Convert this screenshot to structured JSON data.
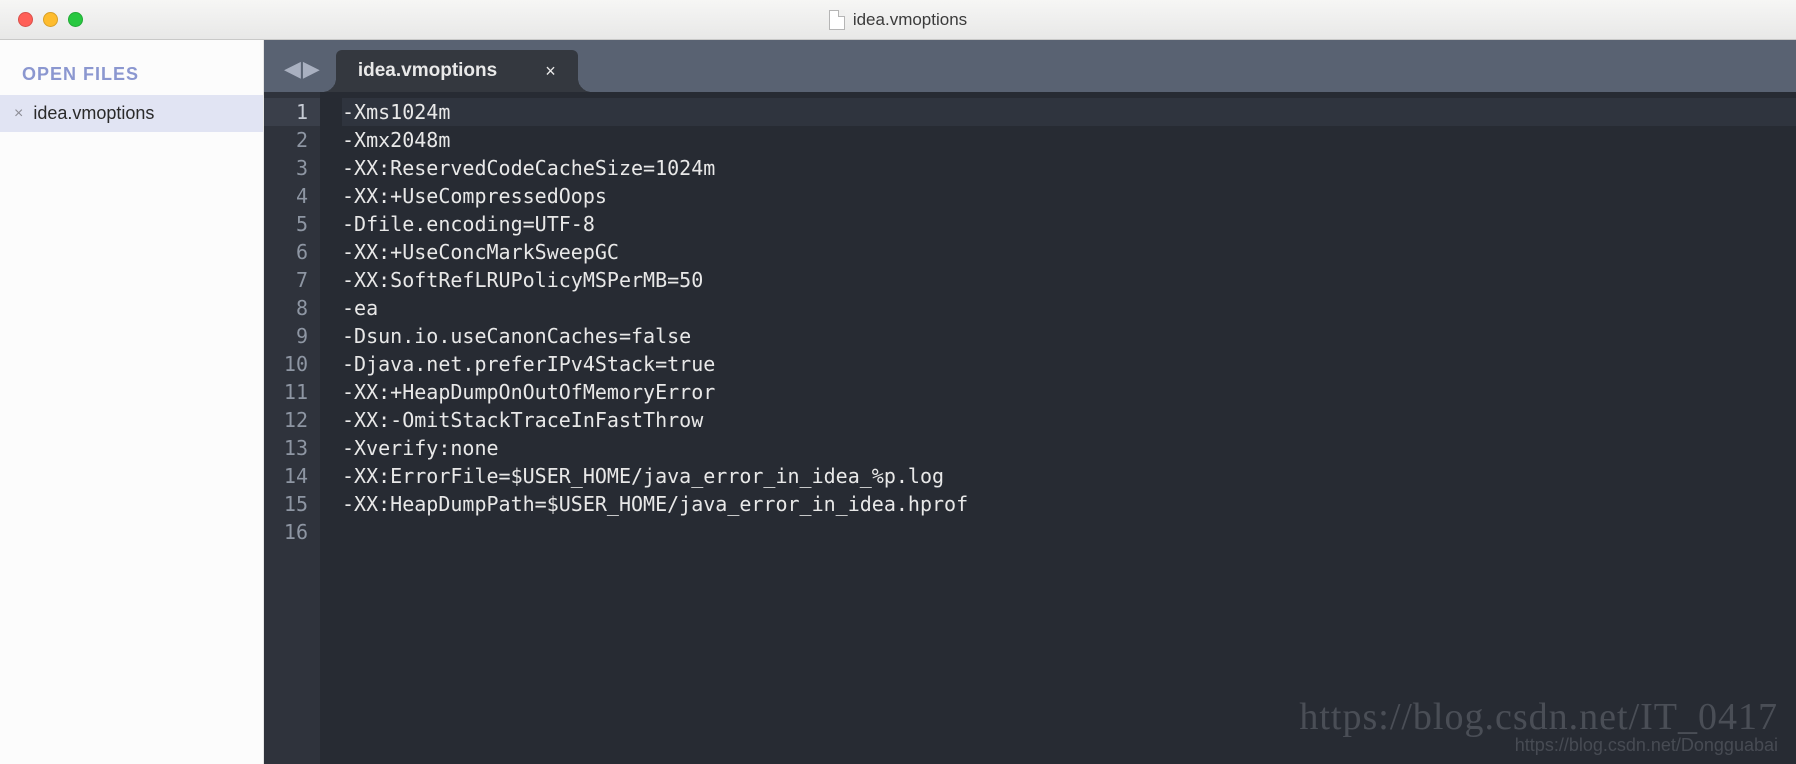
{
  "window": {
    "title": "idea.vmoptions"
  },
  "sidebar": {
    "header": "OPEN FILES",
    "items": [
      {
        "label": "idea.vmoptions"
      }
    ]
  },
  "tabs": [
    {
      "label": "idea.vmoptions",
      "active": true
    }
  ],
  "editor": {
    "current_line": 1,
    "lines": [
      "-Xms1024m",
      "-Xmx2048m",
      "-XX:ReservedCodeCacheSize=1024m",
      "-XX:+UseCompressedOops",
      "-Dfile.encoding=UTF-8",
      "-XX:+UseConcMarkSweepGC",
      "-XX:SoftRefLRUPolicyMSPerMB=50",
      "-ea",
      "-Dsun.io.useCanonCaches=false",
      "-Djava.net.preferIPv4Stack=true",
      "-XX:+HeapDumpOnOutOfMemoryError",
      "-XX:-OmitStackTraceInFastThrow",
      "-Xverify:none",
      "",
      "-XX:ErrorFile=$USER_HOME/java_error_in_idea_%p.log",
      "-XX:HeapDumpPath=$USER_HOME/java_error_in_idea.hprof"
    ]
  },
  "watermark": {
    "line1": "https://blog.csdn.net/IT_0417",
    "line2": "https://blog.csdn.net/Dongguabai"
  }
}
